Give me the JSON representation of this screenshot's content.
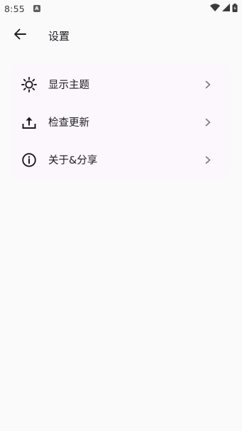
{
  "status_bar": {
    "time": "8:55",
    "notification_badge": "A"
  },
  "app_bar": {
    "title": "设置"
  },
  "settings": {
    "items": [
      {
        "label": "显示主题",
        "icon": "brightness-icon"
      },
      {
        "label": "检查更新",
        "icon": "upload-icon"
      },
      {
        "label": "关于&分享",
        "icon": "info-icon"
      }
    ]
  },
  "colors": {
    "background": "#fafafa",
    "card_background": "#fcf7fd",
    "text_primary": "#1c1b1f",
    "chevron": "#7a7a7a"
  }
}
